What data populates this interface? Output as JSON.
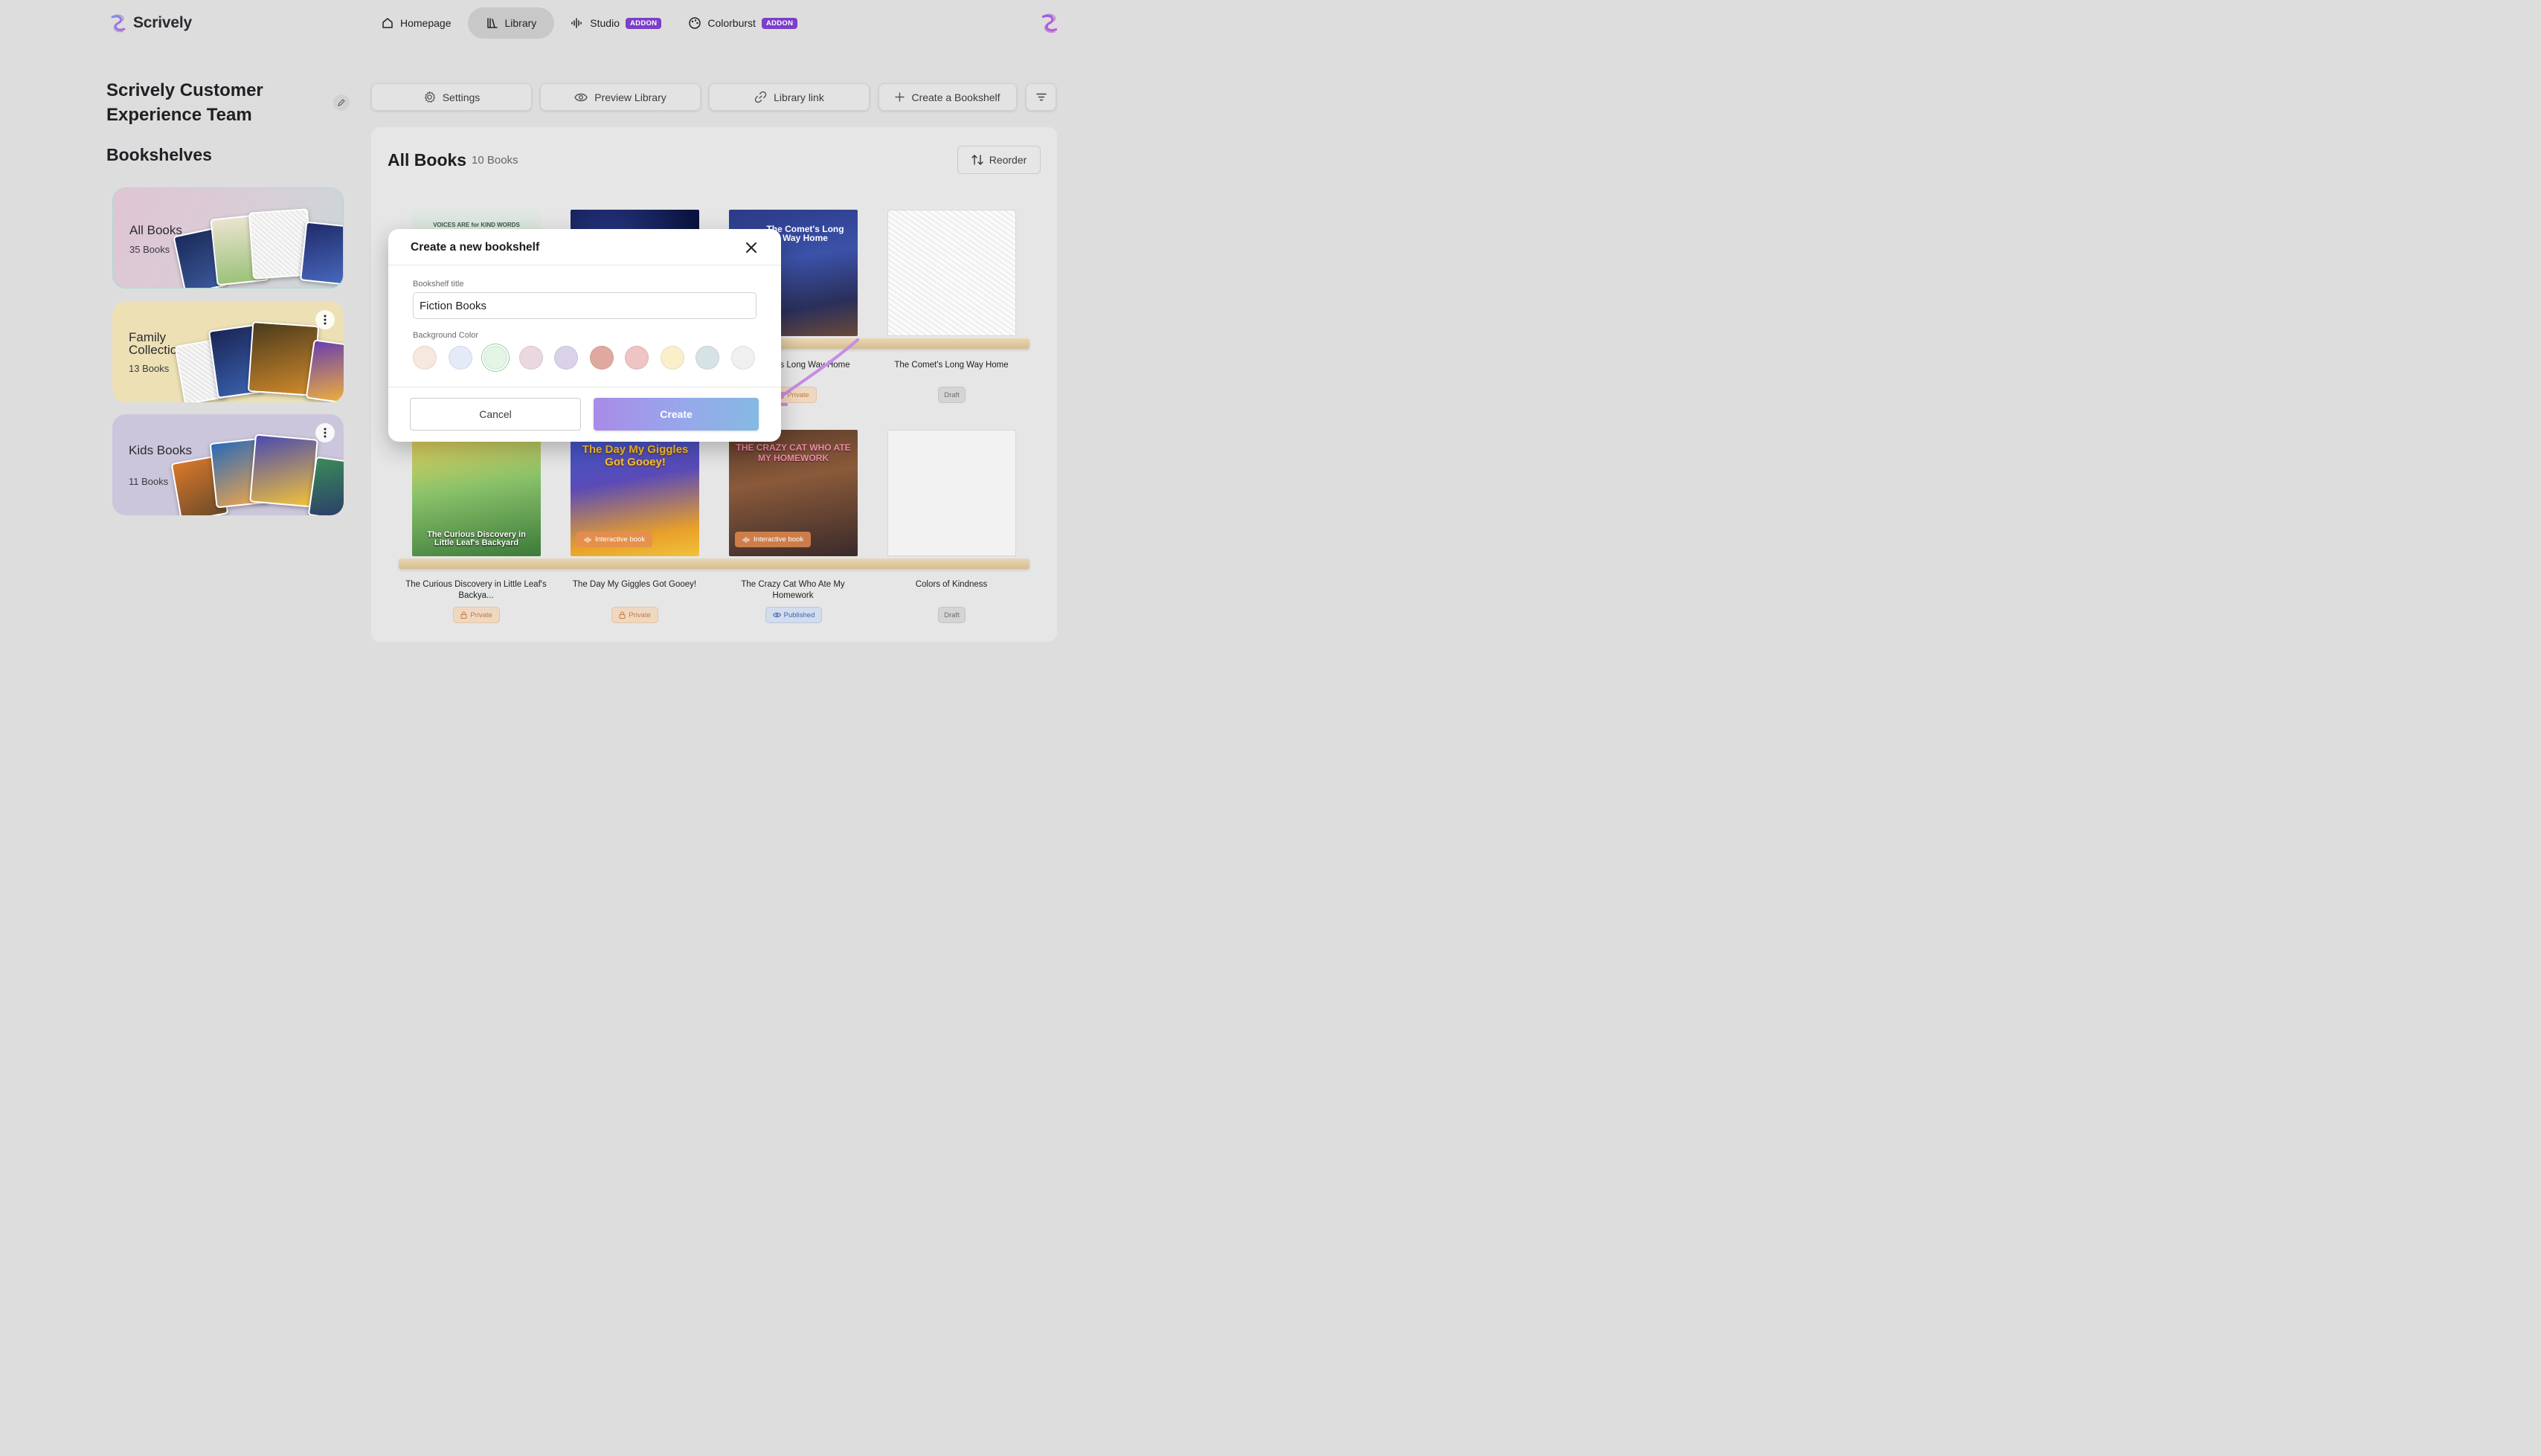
{
  "app": {
    "name": "Scrively"
  },
  "nav": {
    "items": [
      {
        "label": "Homepage",
        "icon": "home-icon",
        "badge": ""
      },
      {
        "label": "Library",
        "icon": "library-icon",
        "badge": "",
        "active": true
      },
      {
        "label": "Studio",
        "icon": "waveform-icon",
        "badge": "ADDON"
      },
      {
        "label": "Colorburst",
        "icon": "palette-icon",
        "badge": "ADDON"
      }
    ]
  },
  "sidebar": {
    "team_name": "Scrively Customer Experience Team",
    "bookshelves_heading": "Bookshelves",
    "shelves": [
      {
        "name": "All Books",
        "count": "35 Books",
        "selected": true
      },
      {
        "name": "Family Collection",
        "count": "13 Books"
      },
      {
        "name": "Kids Books",
        "count": "11 Books"
      }
    ]
  },
  "actions": {
    "settings": "Settings",
    "preview": "Preview Library",
    "link": "Library link",
    "create_shelf": "Create a Bookshelf"
  },
  "main": {
    "title": "All Books",
    "count": "10 Books",
    "reorder": "Reorder",
    "books": [
      {
        "title": "Voices Are for Kind Words",
        "status": ""
      },
      {
        "title": "",
        "status": ""
      },
      {
        "title": "The Comet's Long Way Home",
        "status": "Private",
        "cover_title": "The Comet's Long Way Home"
      },
      {
        "title": "The Comet's Long Way Home",
        "status": "Draft"
      },
      {
        "title": "The Curious Discovery in Little Leaf's Backya...",
        "status": "Private",
        "cover_title": "The Curious Discovery in Little Leaf's Backyard"
      },
      {
        "title": "The Day My Giggles Got Gooey!",
        "status": "Private",
        "tag": "Interactive book",
        "cover_title": "The Day My Giggles Got Gooey!"
      },
      {
        "title": "The Crazy Cat Who Ate My Homework",
        "status": "Published",
        "tag": "Interactive book",
        "cover_title": "THE CRAZY CAT WHO ATE MY HOMEWORK"
      },
      {
        "title": "Colors of Kindness",
        "status": "Draft"
      }
    ],
    "first_book_cover_text": "VOICES ARE for KIND WORDS"
  },
  "modal": {
    "title": "Create a new bookshelf",
    "title_label": "Bookshelf title",
    "title_value": "Fiction Books",
    "color_label": "Background Color",
    "colors": [
      "#f7e8df",
      "#e4eaf8",
      "#e3f5e4",
      "#ead7e0",
      "#d9d2e9",
      "#e0a9a0",
      "#efc4c5",
      "#fbefcb",
      "#d5e2e6",
      "#f0f0f0"
    ],
    "selected_color_index": 2,
    "cancel": "Cancel",
    "create": "Create"
  }
}
